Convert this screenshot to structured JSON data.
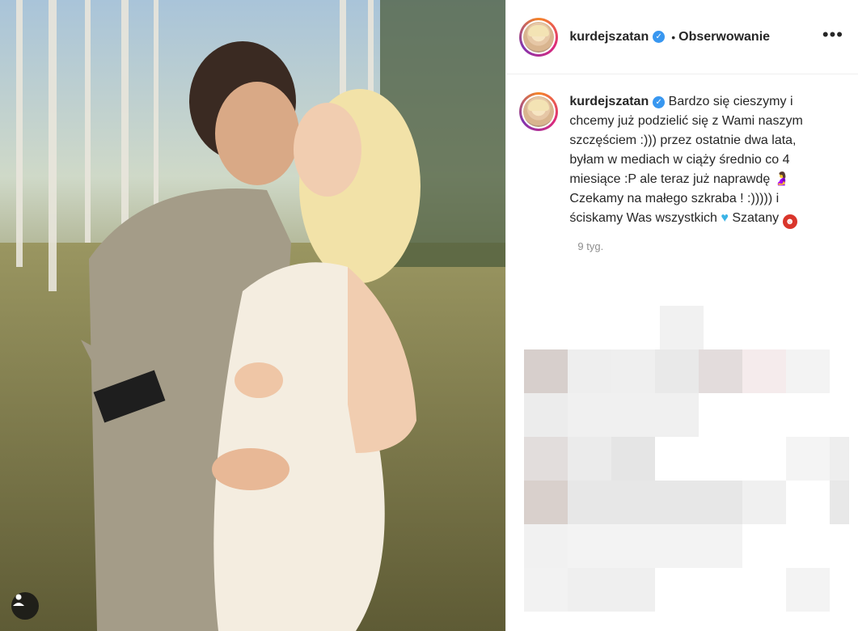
{
  "post": {
    "username": "kurdejszatan",
    "follow_separator": "•",
    "follow_label": "Obserwowanie",
    "more_label": "•••",
    "caption_text": "Bardzo się cieszymy i chcemy już podzielić się z Wami naszym szczęściem :))) przez ostatnie dwa lata, byłam w mediach w ciąży średnio co 4 miesiące :P ale teraz już naprawdę",
    "caption_text_2": "Czekamy na małego szkraba ! :))))) i ściskamy Was wszystkich",
    "caption_text_3": "Szatany",
    "timestamp": "9 tyg.",
    "icons": {
      "verified": "verified-badge-icon",
      "pregnant": "pregnant-woman-emoji",
      "heart": "blue-heart-emoji",
      "devil": "smiling-devil-emoji",
      "tag": "user-tag-icon",
      "more": "more-options-icon"
    },
    "colors": {
      "verified": "#3897f0",
      "text": "#262626",
      "muted": "#8e8e8e",
      "heart": "#3bb4e6",
      "devil": "#d9352b"
    }
  }
}
